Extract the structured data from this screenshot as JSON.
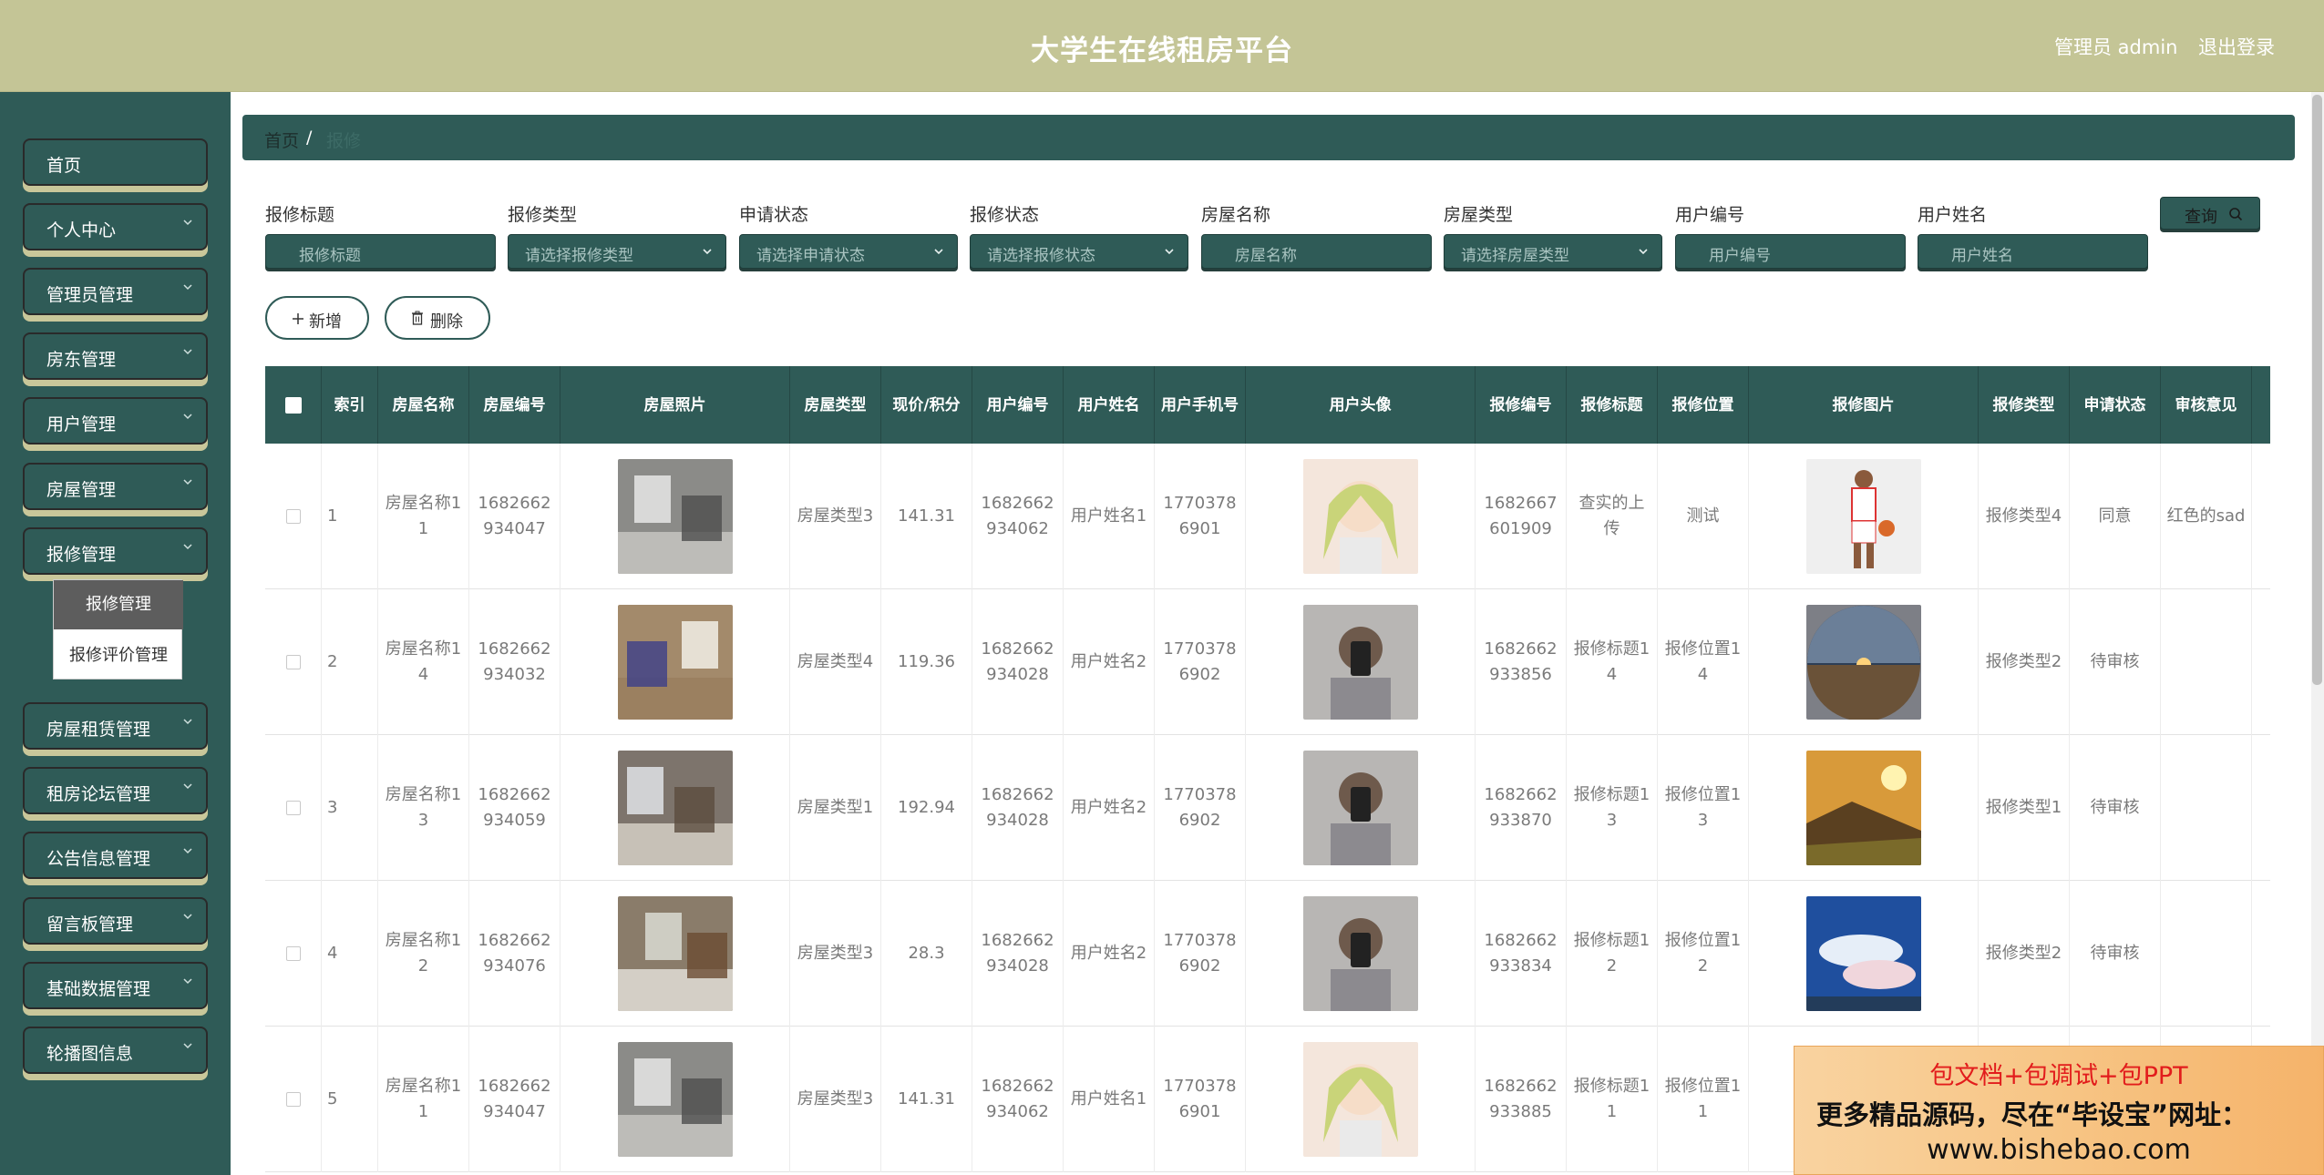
{
  "header": {
    "title": "大学生在线租房平台",
    "admin": "管理员 admin",
    "logout": "退出登录"
  },
  "sidebar": {
    "items": [
      {
        "label": "首页"
      },
      {
        "label": "个人中心"
      },
      {
        "label": "管理员管理"
      },
      {
        "label": "房东管理"
      },
      {
        "label": "用户管理"
      },
      {
        "label": "房屋管理"
      },
      {
        "label": "报修管理"
      },
      {
        "label": "房屋租赁管理"
      },
      {
        "label": "租房论坛管理"
      },
      {
        "label": "公告信息管理"
      },
      {
        "label": "留言板管理"
      },
      {
        "label": "基础数据管理"
      },
      {
        "label": "轮播图信息"
      }
    ],
    "submenu": [
      "报修管理",
      "报修评价管理"
    ]
  },
  "breadcrumb": {
    "home": "首页",
    "sep": "/",
    "current": "报修"
  },
  "search": {
    "fields": [
      {
        "label": "报修标题",
        "placeholder": "报修标题"
      },
      {
        "label": "报修类型",
        "placeholder": "请选择报修类型"
      },
      {
        "label": "申请状态",
        "placeholder": "请选择申请状态"
      },
      {
        "label": "报修状态",
        "placeholder": "请选择报修状态"
      },
      {
        "label": "房屋名称",
        "placeholder": "房屋名称"
      },
      {
        "label": "房屋类型",
        "placeholder": "请选择房屋类型"
      },
      {
        "label": "用户编号",
        "placeholder": "用户编号"
      },
      {
        "label": "用户姓名",
        "placeholder": "用户姓名"
      }
    ],
    "query_label": "查询"
  },
  "actions": {
    "add": "新增",
    "delete": "删除"
  },
  "table": {
    "headers": [
      "索引",
      "房屋名称",
      "房屋编号",
      "房屋照片",
      "房屋类型",
      "现价/积分",
      "用户编号",
      "用户姓名",
      "用户手机号",
      "用户头像",
      "报修编号",
      "报修标题",
      "报修位置",
      "报修图片",
      "报修类型",
      "申请状态",
      "审核意见"
    ],
    "rows": [
      {
        "idx": "1",
        "name": "房屋名称11",
        "code": "1682662934047",
        "type": "房屋类型3",
        "price": "141.31",
        "uid": "1682662934062",
        "uname": "用户姓名1",
        "phone": "17703786901",
        "rcode": "1682667601909",
        "rtitle": "查实的上传",
        "rpos": "测试",
        "rtype": "报修类型4",
        "status": "同意",
        "opinion": "红色的sad"
      },
      {
        "idx": "2",
        "name": "房屋名称14",
        "code": "1682662934032",
        "type": "房屋类型4",
        "price": "119.36",
        "uid": "1682662934028",
        "uname": "用户姓名2",
        "phone": "17703786902",
        "rcode": "1682662933856",
        "rtitle": "报修标题14",
        "rpos": "报修位置14",
        "rtype": "报修类型2",
        "status": "待审核",
        "opinion": ""
      },
      {
        "idx": "3",
        "name": "房屋名称13",
        "code": "1682662934059",
        "type": "房屋类型1",
        "price": "192.94",
        "uid": "1682662934028",
        "uname": "用户姓名2",
        "phone": "17703786902",
        "rcode": "1682662933870",
        "rtitle": "报修标题13",
        "rpos": "报修位置13",
        "rtype": "报修类型1",
        "status": "待审核",
        "opinion": ""
      },
      {
        "idx": "4",
        "name": "房屋名称12",
        "code": "1682662934076",
        "type": "房屋类型3",
        "price": "28.3",
        "uid": "1682662934028",
        "uname": "用户姓名2",
        "phone": "17703786902",
        "rcode": "1682662933834",
        "rtitle": "报修标题12",
        "rpos": "报修位置12",
        "rtype": "报修类型2",
        "status": "待审核",
        "opinion": ""
      },
      {
        "idx": "5",
        "name": "房屋名称11",
        "code": "1682662934047",
        "type": "房屋类型3",
        "price": "141.31",
        "uid": "1682662934062",
        "uname": "用户姓名1",
        "phone": "17703786901",
        "rcode": "1682662933885",
        "rtitle": "报修标题11",
        "rpos": "报修位置11",
        "rtype": "",
        "status": "",
        "opinion": ""
      }
    ]
  },
  "ad": {
    "line1": "包文档+包调试+包PPT",
    "line2": "更多精品源码，尽在“毕设宝”网址：",
    "line3": "www.bishebao.com"
  }
}
